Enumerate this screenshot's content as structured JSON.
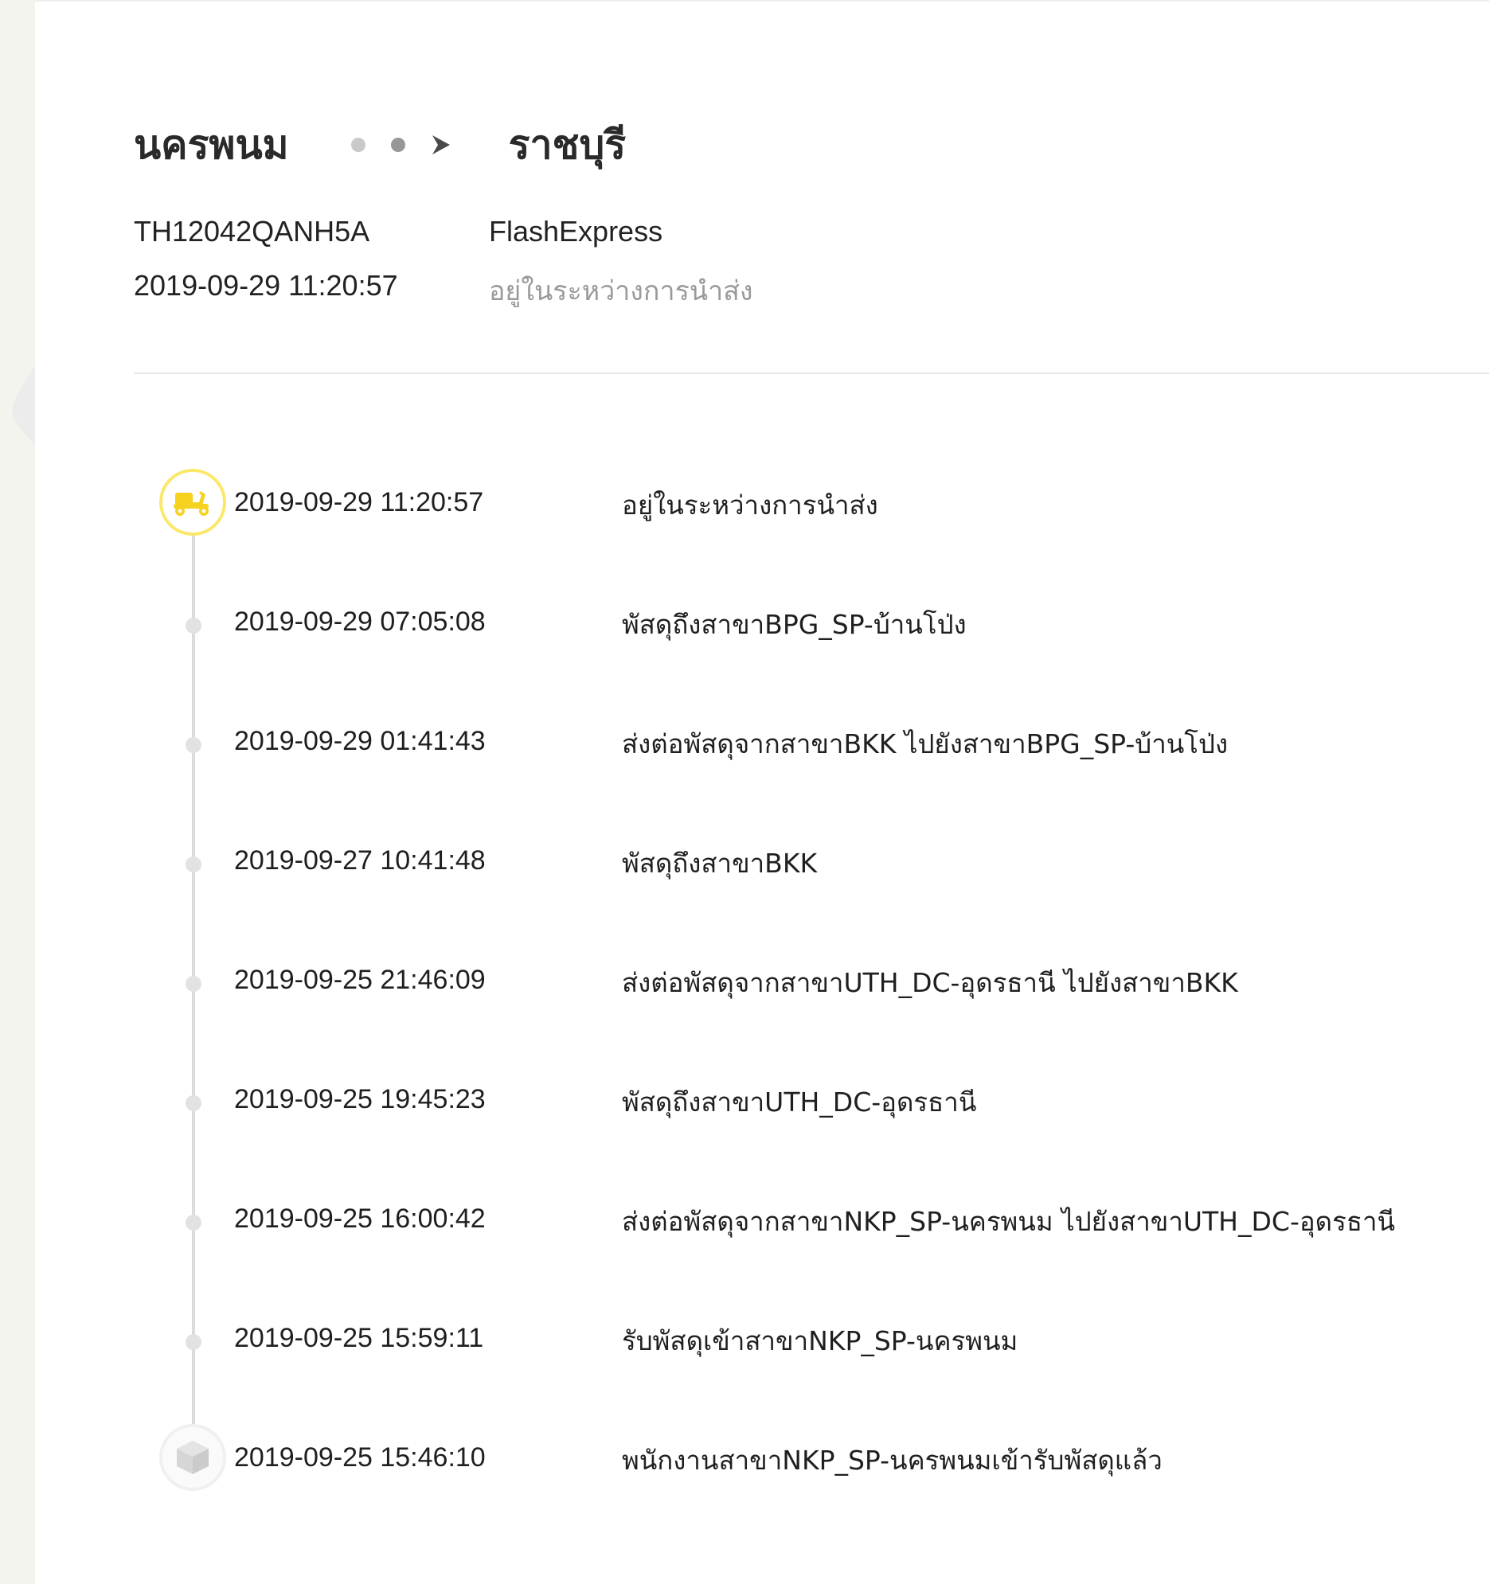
{
  "route": {
    "origin": "นครพนม",
    "destination": "ราชบุรี"
  },
  "parcel": {
    "tracking_number": "TH12042QANH5A",
    "carrier": "FlashExpress",
    "last_update": "2019-09-29 11:20:57",
    "status": "อยู่ในระหว่างการนำส่ง"
  },
  "colors": {
    "accent": "#fbe86a",
    "scooter_icon": "#f6d21f",
    "timeline_line": "#dcdcdc",
    "status_muted": "#9a9a9a"
  },
  "icons": {
    "current": "scooter-icon",
    "first": "box-icon",
    "route_arrow": "arrow-right-icon"
  },
  "events": [
    {
      "time": "2019-09-29 11:20:57",
      "desc": "อยู่ในระหว่างการนำส่ง"
    },
    {
      "time": "2019-09-29 07:05:08",
      "desc": "พัสดุถึงสาขาBPG_SP-บ้านโป่ง"
    },
    {
      "time": "2019-09-29 01:41:43",
      "desc": "ส่งต่อพัสดุจากสาขาBKK ไปยังสาขาBPG_SP-บ้านโป่ง"
    },
    {
      "time": "2019-09-27 10:41:48",
      "desc": "พัสดุถึงสาขาBKK"
    },
    {
      "time": "2019-09-25 21:46:09",
      "desc": "ส่งต่อพัสดุจากสาขาUTH_DC-อุดรธานี ไปยังสาขาBKK"
    },
    {
      "time": "2019-09-25 19:45:23",
      "desc": "พัสดุถึงสาขาUTH_DC-อุดรธานี"
    },
    {
      "time": "2019-09-25 16:00:42",
      "desc": "ส่งต่อพัสดุจากสาขาNKP_SP-นครพนม ไปยังสาขาUTH_DC-อุดรธานี"
    },
    {
      "time": "2019-09-25 15:59:11",
      "desc": "รับพัสดุเข้าสาขาNKP_SP-นครพนม"
    },
    {
      "time": "2019-09-25 15:46:10",
      "desc": "พนักงานสาขาNKP_SP-นครพนมเข้ารับพัสดุแล้ว"
    }
  ]
}
